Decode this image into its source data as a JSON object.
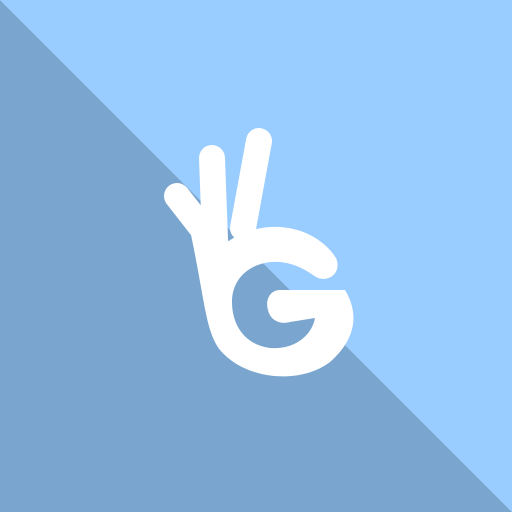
{
  "icon": {
    "name": "ok-hand-g-icon",
    "colors": {
      "light_bg": "#99CCFF",
      "dark_bg": "#79A5CF",
      "glyph": "#FFFFFF"
    }
  }
}
